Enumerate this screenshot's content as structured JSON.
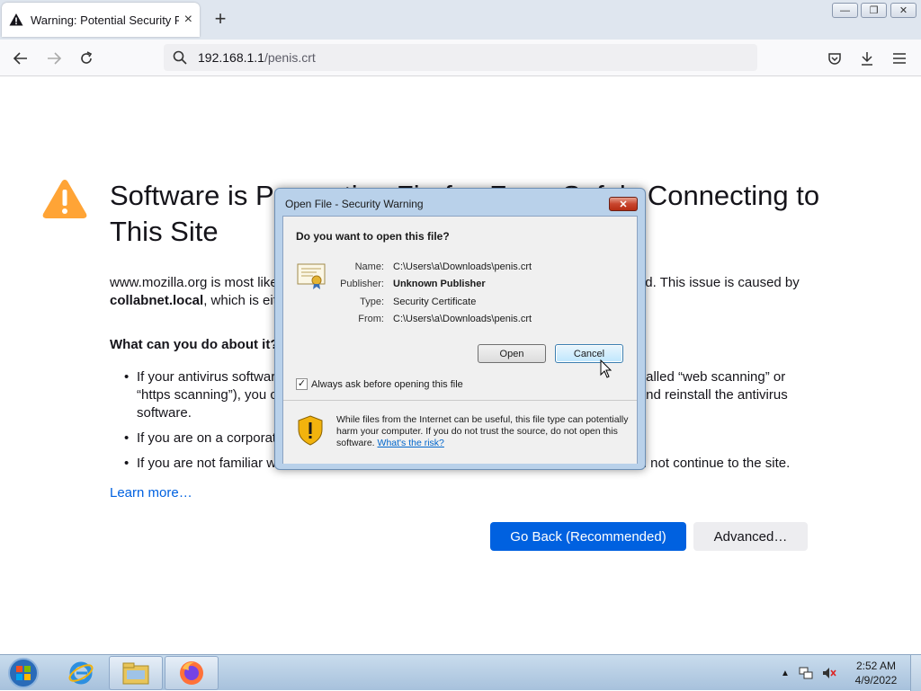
{
  "browser": {
    "tab_title": "Warning: Potential Security Risk",
    "tab_close": "×",
    "new_tab": "+",
    "url_host": "192.168.1.1",
    "url_path": "/penis.crt",
    "window_controls": {
      "minimize": "—",
      "restore": "❐",
      "close": "✕"
    }
  },
  "page": {
    "title": "Software is Preventing Firefox From Safely Connecting to This Site",
    "intro_prefix": "www.mozilla.org is most likely a safe site, but a secure connection could not be established. This issue is caused by ",
    "intro_bold": "collabnet.local",
    "intro_suffix": ", which is either software on your computer or your network.",
    "what_heading": "What can you do about it?",
    "bullets": [
      "If your antivirus software includes a feature that scans encrypted connections (often called “web scanning” or “https scanning”), you can disable that feature. If that doesn’t work, you can remove and reinstall the antivirus software.",
      "If you are on a corporate network, you can contact your IT department.",
      "If you are not familiar with collabnet.local, then this could be an attack and you should not continue to the site."
    ],
    "learn_more": "Learn more…",
    "go_back": "Go Back (Recommended)",
    "advanced": "Advanced…"
  },
  "dialog": {
    "title": "Open File - Security Warning",
    "close": "✕",
    "question": "Do you want to open this file?",
    "fields": {
      "name_label": "Name:",
      "name_value": "C:\\Users\\a\\Downloads\\penis.crt",
      "publisher_label": "Publisher:",
      "publisher_value": "Unknown Publisher",
      "type_label": "Type:",
      "type_value": "Security Certificate",
      "from_label": "From:",
      "from_value": "C:\\Users\\a\\Downloads\\penis.crt"
    },
    "open_button": "Open",
    "cancel_button": "Cancel",
    "checkbox_label": "Always ask before opening this file",
    "checkbox_checked": "✓",
    "warning_text": "While files from the Internet can be useful, this file type can potentially harm your computer. If you do not trust the source, do not open this software. ",
    "risk_link": "What's the risk?"
  },
  "taskbar": {
    "clock_time": "2:52 AM",
    "clock_date": "4/9/2022",
    "tray_arrow": "▲"
  },
  "colors": {
    "primary": "#0061e0",
    "warning": "#ffa436"
  }
}
